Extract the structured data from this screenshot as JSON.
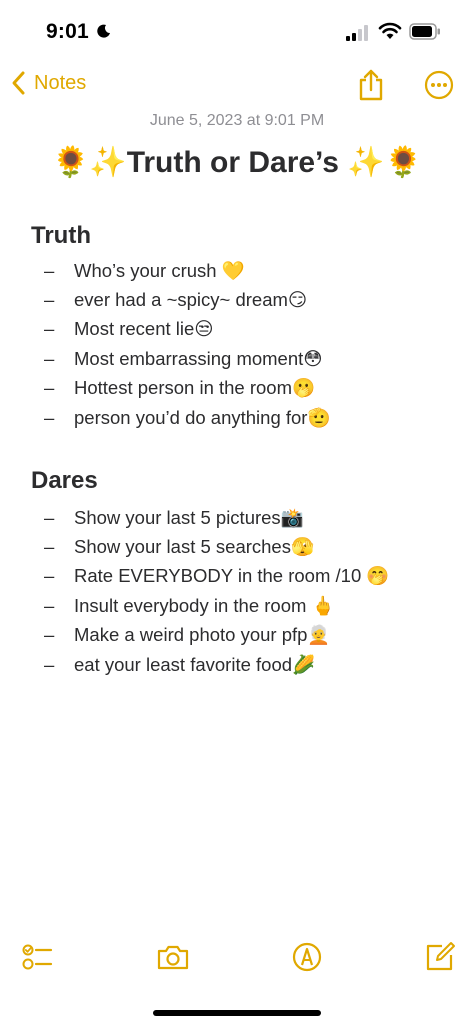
{
  "status_bar": {
    "time": "9:01"
  },
  "nav": {
    "back_label": "Notes"
  },
  "note": {
    "date": "June 5, 2023 at 9:01 PM",
    "title": "🌻✨Truth or Dare’s ✨🌻",
    "sections": [
      {
        "heading": "Truth",
        "items": [
          "Who’s your crush 💛",
          "ever had a ~spicy~ dream😏",
          "Most recent lie😒",
          "Most embarrassing moment😳",
          "Hottest person in the room🫢",
          "person you’d do anything for🫡"
        ]
      },
      {
        "heading": "Dares",
        "items": [
          "Show your last 5 pictures📸",
          "Show your last 5 searches🫣",
          "Rate EVERYBODY in the room /10 🤭",
          "Insult everybody in the room 🖕",
          "Make a weird photo your pfp🧑‍🦳",
          "eat your least favorite food🌽"
        ]
      }
    ]
  },
  "toolbar": {
    "icons": [
      "checklist-icon",
      "camera-icon",
      "markup-icon",
      "compose-icon"
    ]
  },
  "colors": {
    "accent": "#e0a800",
    "text": "#2c2c2e",
    "secondary": "#8e8e93"
  }
}
